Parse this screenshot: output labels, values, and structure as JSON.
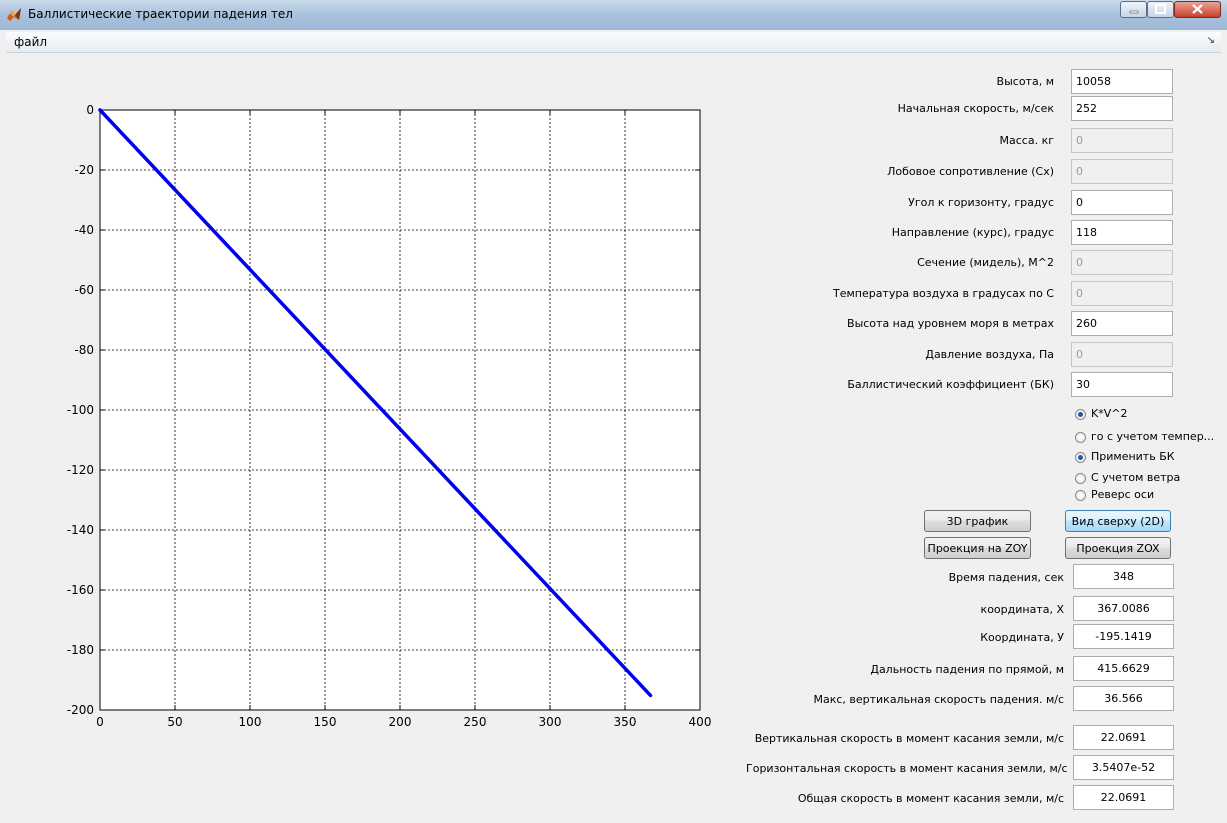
{
  "window": {
    "title": "Баллистические траектории падения тел",
    "menu": [
      "файл"
    ]
  },
  "chart_data": {
    "type": "line",
    "xlim": [
      0,
      400
    ],
    "ylim": [
      -200,
      0
    ],
    "x_ticks": [
      0,
      50,
      100,
      150,
      200,
      250,
      300,
      350,
      400
    ],
    "y_ticks": [
      0,
      -20,
      -40,
      -60,
      -80,
      -100,
      -120,
      -140,
      -160,
      -180,
      -200
    ],
    "grid": true,
    "series": [
      {
        "x": [
          0,
          367.0086
        ],
        "y": [
          0,
          -195.1419
        ],
        "color": "#0000ee"
      }
    ],
    "title": "",
    "xlabel": "",
    "ylabel": ""
  },
  "inputs": [
    {
      "label": "Высота, м",
      "value": "10058",
      "enabled": true
    },
    {
      "label": "Начальная скорость, м/сек",
      "value": "252",
      "enabled": true
    },
    {
      "label": "Масса. кг",
      "value": "0",
      "enabled": false
    },
    {
      "label": "Лобовое сопротивление (Сх)",
      "value": "0",
      "enabled": false
    },
    {
      "label": "Угол к горизонту, градус",
      "value": "0",
      "enabled": true
    },
    {
      "label": "Направление  (курс), градус",
      "value": "118",
      "enabled": true
    },
    {
      "label": "Сечение (мидель), М^2",
      "value": "0",
      "enabled": false
    },
    {
      "label": "Температура воздуха в градусах по С",
      "value": "0",
      "enabled": false
    },
    {
      "label": "Высота над уровнем моря в метрах",
      "value": "260",
      "enabled": true
    },
    {
      "label": "Давление воздуха, Па",
      "value": "0",
      "enabled": false
    },
    {
      "label": "Баллистический коэффициент (БК)",
      "value": "30",
      "enabled": true
    }
  ],
  "options": [
    {
      "label": "K*V^2",
      "checked": true
    },
    {
      "label": "го с учетом темпер...",
      "checked": false
    },
    {
      "label": "Применить БК",
      "checked": true
    },
    {
      "label": "С учетом ветра",
      "checked": false
    },
    {
      "label": "Реверс оси",
      "checked": false
    }
  ],
  "buttons": {
    "plot3d": "3D график",
    "topview": "Вид сверху (2D)",
    "proj_zoy": "Проекция на ZOY",
    "proj_zox": "Проекция ZOX"
  },
  "results": [
    {
      "label": "Время падения, сек",
      "value": "348"
    },
    {
      "label": "координата, X",
      "value": "367.0086"
    },
    {
      "label": "Координата, У",
      "value": "-195.1419"
    },
    {
      "label": "Дальность падения по прямой, м",
      "value": "415.6629"
    },
    {
      "label": "Макс,  вертикальная скорость падения. м/с",
      "value": "36.566"
    },
    {
      "label": "Вертикальная  скорость в момент касания земли, м/с",
      "value": "22.0691"
    },
    {
      "label": "Горизонтальная скорость в момент касания земли, м/с",
      "value": "3.5407e-52"
    },
    {
      "label": "Общая скорость в момент касания земли, м/с",
      "value": "22.0691"
    }
  ]
}
